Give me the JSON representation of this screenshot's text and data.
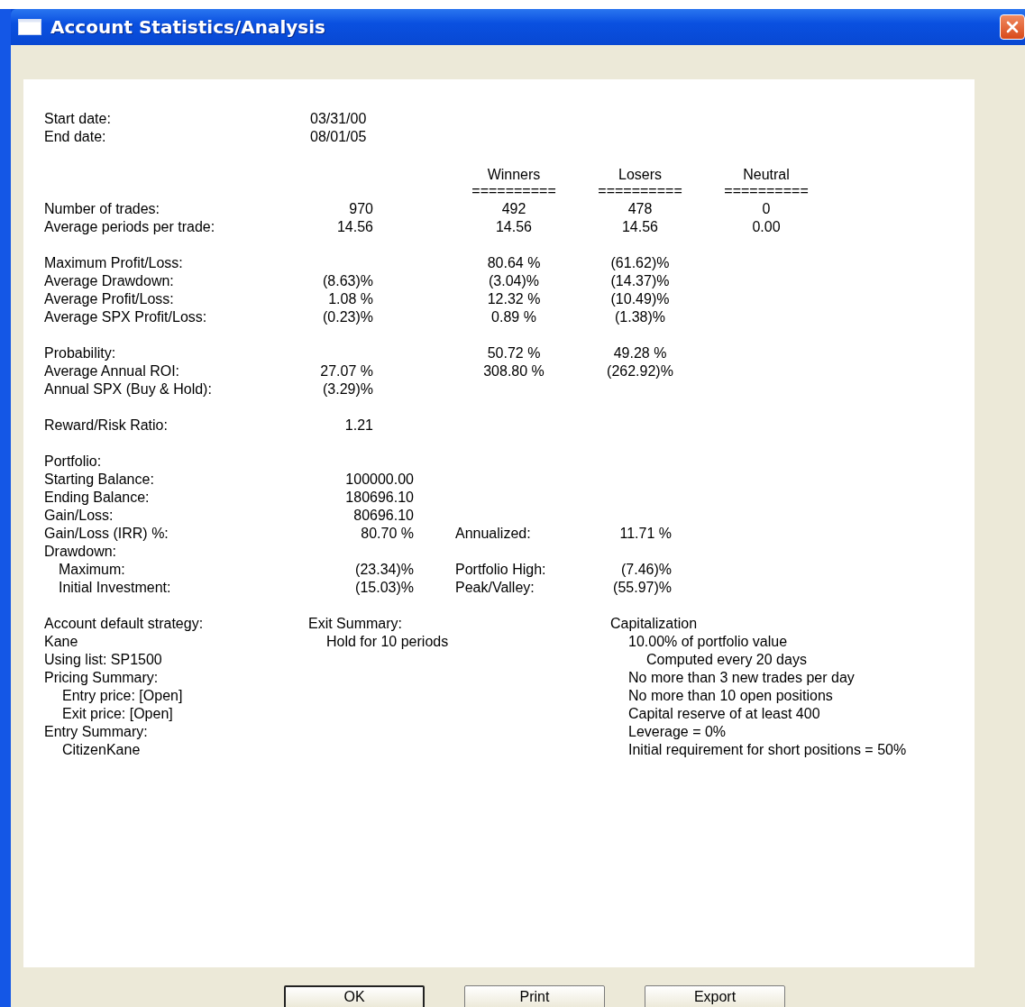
{
  "window": {
    "title": "Account Statistics/Analysis"
  },
  "dates": [
    {
      "label": "Start date:",
      "value": "03/31/00"
    },
    {
      "label": "End date:",
      "value": "08/01/05"
    }
  ],
  "trade_stats": {
    "columns": [
      {
        "heading": "Winners",
        "rule": "=========="
      },
      {
        "heading": "Losers",
        "rule": "=========="
      },
      {
        "heading": "Neutral",
        "rule": "=========="
      }
    ],
    "groups": [
      [
        {
          "label": "Number of trades:",
          "total": "970",
          "values": [
            "492",
            "478",
            "0"
          ]
        },
        {
          "label": "Average periods per trade:",
          "total": "14.56",
          "values": [
            "14.56",
            "14.56",
            "0.00"
          ]
        }
      ],
      [
        {
          "label": "Maximum Profit/Loss:",
          "values": [
            "80.64 %",
            "(61.62)%"
          ]
        },
        {
          "label": "Average Drawdown:",
          "total": "(8.63)%",
          "values": [
            "(3.04)%",
            "(14.37)%"
          ]
        },
        {
          "label": "Average Profit/Loss:",
          "total": "1.08 %",
          "values": [
            "12.32 %",
            "(10.49)%"
          ]
        },
        {
          "label": "Average SPX Profit/Loss:",
          "total": "(0.23)%",
          "values": [
            "0.89 %",
            "(1.38)%"
          ]
        }
      ],
      [
        {
          "label": "Probability:",
          "values": [
            "50.72 %",
            "49.28 %"
          ]
        },
        {
          "label": "Average Annual ROI:",
          "total": "27.07 %",
          "values": [
            "308.80 %",
            "(262.92)%"
          ]
        },
        {
          "label": "Annual SPX (Buy & Hold):",
          "total": "(3.29)%"
        }
      ],
      [
        {
          "label": "Reward/Risk Ratio:",
          "total": "1.21"
        }
      ]
    ]
  },
  "portfolio": {
    "title": "Portfolio:",
    "rows": [
      {
        "label": "Starting Balance:",
        "value": "100000.00"
      },
      {
        "label": "Ending Balance:",
        "value": "180696.10"
      },
      {
        "label": "Gain/Loss:",
        "value": "80696.10"
      },
      {
        "label": "Gain/Loss (IRR) %:",
        "value": "80.70 %",
        "extra_label": "Annualized:",
        "extra_value": "11.71 %"
      },
      {
        "label": "Drawdown:",
        "children": [
          {
            "label": "Maximum:",
            "value": "(23.34)%",
            "extra_label": "Portfolio High:",
            "extra_value": "(7.46)%"
          },
          {
            "label": "Initial Investment:",
            "value": "(15.03)%",
            "extra_label": "Peak/Valley:",
            "extra_value": "(55.97)%"
          }
        ]
      }
    ]
  },
  "summary_columns": [
    [
      {
        "text": "Account default strategy:"
      },
      {
        "text": "Kane"
      },
      {
        "text": "Using list:  SP1500"
      },
      {
        "text": "Pricing Summary:",
        "children": [
          {
            "text": "Entry price:  [Open]"
          },
          {
            "text": "Exit price:  [Open]"
          }
        ]
      },
      {
        "text": "Entry Summary:",
        "children": [
          {
            "text": "CitizenKane"
          }
        ]
      }
    ],
    [
      {
        "text": "Exit Summary:",
        "children": [
          {
            "text": "Hold for 10 periods"
          }
        ]
      }
    ],
    [
      {
        "text": "Capitalization",
        "children": [
          {
            "text": "10.00% of portfolio value",
            "children": [
              {
                "text": "Computed every 20 days"
              }
            ]
          },
          {
            "text": "No more than 3 new trades per day"
          },
          {
            "text": "No more than 10 open positions"
          },
          {
            "text": "Capital reserve of at least 400"
          },
          {
            "text": "Leverage = 0%"
          },
          {
            "text": "Initial requirement for short positions = 50%"
          }
        ]
      }
    ]
  ],
  "buttons": [
    "OK",
    "Print",
    "Export"
  ]
}
